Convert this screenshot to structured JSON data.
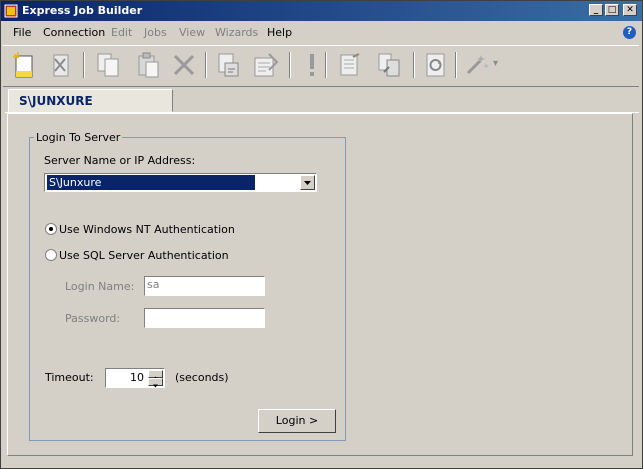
{
  "window": {
    "title": "Express Job Builder"
  },
  "title_buttons": {
    "minimize": "_",
    "maximize": "□",
    "close": "✕"
  },
  "menu": [
    {
      "label": "File",
      "enabled": true
    },
    {
      "label": "Connection",
      "enabled": true
    },
    {
      "label": "Edit",
      "enabled": false
    },
    {
      "label": "Jobs",
      "enabled": false
    },
    {
      "label": "View",
      "enabled": false
    },
    {
      "label": "Wizards",
      "enabled": false
    },
    {
      "label": "Help",
      "enabled": true
    }
  ],
  "help_icon_text": "?",
  "toolbar": {
    "icons": [
      "new-job-icon",
      "delete-job-icon",
      "copy-icon",
      "paste-icon",
      "delete-icon",
      "script-icon",
      "properties-icon",
      "alert-icon",
      "job-list-icon",
      "copy-job-icon",
      "refresh-icon",
      "wizard-icon"
    ],
    "wizard_dropdown": "▾"
  },
  "tab": {
    "label": "S\\JUNXURE"
  },
  "login": {
    "group_title": "Login To Server",
    "server_label": "Server Name or IP Address:",
    "server_value": "S\\Junxure",
    "nt_auth_label": "Use Windows NT Authentication",
    "sql_auth_label": "Use SQL Server Authentication",
    "login_name_label": "Login Name:",
    "login_name_value": "sa",
    "password_label": "Password:",
    "password_value": "",
    "timeout_label": "Timeout:",
    "timeout_value": "10",
    "timeout_unit": "(seconds)",
    "login_button": "Login >",
    "nt_auth_selected": true
  },
  "colors": {
    "titlebar": "#0a246a",
    "tab_text": "#0a246a",
    "selection": "#0a246a"
  }
}
